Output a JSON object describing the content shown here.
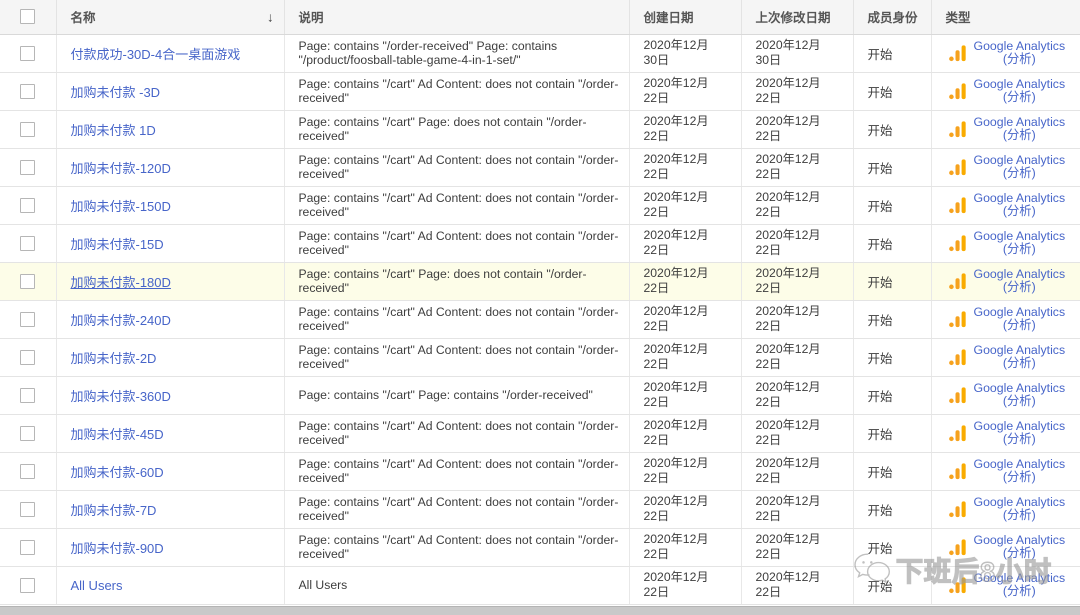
{
  "table": {
    "sort_indicator": "↓",
    "columns": [
      {
        "key": "check",
        "label": ""
      },
      {
        "key": "name",
        "label": "名称"
      },
      {
        "key": "desc",
        "label": "说明"
      },
      {
        "key": "cdate",
        "label": "创建日期"
      },
      {
        "key": "mdate",
        "label": "上次修改日期"
      },
      {
        "key": "member",
        "label": "成员身份"
      },
      {
        "key": "type",
        "label": "类型"
      }
    ],
    "type_icon_name": "google-analytics-icon",
    "type_label_main": "Google Analytics",
    "type_label_sub": "(分析)",
    "accent_link_color": "#4765c9",
    "hover_row_color": "#fdfde8",
    "icon_orange": "#f9ab00",
    "rows": [
      {
        "name": "付款成功-30D-4合一桌面游戏",
        "desc": "Page: contains \"/order-received\" Page: contains \"/product/foosball-table-game-4-in-1-set/\"",
        "cdate_line1": "2020年12月",
        "cdate_line2": "30日",
        "mdate_line1": "2020年12月",
        "mdate_line2": "30日",
        "member": "开始",
        "highlighted": false
      },
      {
        "name": "加购未付款 -3D",
        "desc": "Page: contains \"/cart\" Ad Content: does not contain \"/order-received\"",
        "cdate_line1": "2020年12月",
        "cdate_line2": "22日",
        "mdate_line1": "2020年12月",
        "mdate_line2": "22日",
        "member": "开始",
        "highlighted": false
      },
      {
        "name": "加购未付款 1D",
        "desc": "Page: contains \"/cart\" Page: does not contain \"/order-received\"",
        "cdate_line1": "2020年12月",
        "cdate_line2": "22日",
        "mdate_line1": "2020年12月",
        "mdate_line2": "22日",
        "member": "开始",
        "highlighted": false
      },
      {
        "name": "加购未付款-120D",
        "desc": "Page: contains \"/cart\" Ad Content: does not contain \"/order-received\"",
        "cdate_line1": "2020年12月",
        "cdate_line2": "22日",
        "mdate_line1": "2020年12月",
        "mdate_line2": "22日",
        "member": "开始",
        "highlighted": false
      },
      {
        "name": "加购未付款-150D",
        "desc": "Page: contains \"/cart\" Ad Content: does not contain \"/order-received\"",
        "cdate_line1": "2020年12月",
        "cdate_line2": "22日",
        "mdate_line1": "2020年12月",
        "mdate_line2": "22日",
        "member": "开始",
        "highlighted": false
      },
      {
        "name": "加购未付款-15D",
        "desc": "Page: contains \"/cart\" Ad Content: does not contain \"/order-received\"",
        "cdate_line1": "2020年12月",
        "cdate_line2": "22日",
        "mdate_line1": "2020年12月",
        "mdate_line2": "22日",
        "member": "开始",
        "highlighted": false
      },
      {
        "name": "加购未付款-180D",
        "desc": "Page: contains \"/cart\" Page: does not contain \"/order-received\"",
        "cdate_line1": "2020年12月",
        "cdate_line2": "22日",
        "mdate_line1": "2020年12月",
        "mdate_line2": "22日",
        "member": "开始",
        "highlighted": true
      },
      {
        "name": "加购未付款-240D",
        "desc": "Page: contains \"/cart\" Ad Content: does not contain \"/order-received\"",
        "cdate_line1": "2020年12月",
        "cdate_line2": "22日",
        "mdate_line1": "2020年12月",
        "mdate_line2": "22日",
        "member": "开始",
        "highlighted": false
      },
      {
        "name": "加购未付款-2D",
        "desc": "Page: contains \"/cart\" Ad Content: does not contain \"/order-received\"",
        "cdate_line1": "2020年12月",
        "cdate_line2": "22日",
        "mdate_line1": "2020年12月",
        "mdate_line2": "22日",
        "member": "开始",
        "highlighted": false
      },
      {
        "name": "加购未付款-360D",
        "desc": "Page: contains \"/cart\" Page: contains \"/order-received\"",
        "cdate_line1": "2020年12月",
        "cdate_line2": "22日",
        "mdate_line1": "2020年12月",
        "mdate_line2": "22日",
        "member": "开始",
        "highlighted": false
      },
      {
        "name": "加购未付款-45D",
        "desc": "Page: contains \"/cart\" Ad Content: does not contain \"/order-received\"",
        "cdate_line1": "2020年12月",
        "cdate_line2": "22日",
        "mdate_line1": "2020年12月",
        "mdate_line2": "22日",
        "member": "开始",
        "highlighted": false
      },
      {
        "name": "加购未付款-60D",
        "desc": "Page: contains \"/cart\" Ad Content: does not contain \"/order-received\"",
        "cdate_line1": "2020年12月",
        "cdate_line2": "22日",
        "mdate_line1": "2020年12月",
        "mdate_line2": "22日",
        "member": "开始",
        "highlighted": false
      },
      {
        "name": "加购未付款-7D",
        "desc": "Page: contains \"/cart\" Ad Content: does not contain \"/order-received\"",
        "cdate_line1": "2020年12月",
        "cdate_line2": "22日",
        "mdate_line1": "2020年12月",
        "mdate_line2": "22日",
        "member": "开始",
        "highlighted": false
      },
      {
        "name": "加购未付款-90D",
        "desc": "Page: contains \"/cart\" Ad Content: does not contain \"/order-received\"",
        "cdate_line1": "2020年12月",
        "cdate_line2": "22日",
        "mdate_line1": "2020年12月",
        "mdate_line2": "22日",
        "member": "开始",
        "highlighted": false
      },
      {
        "name": "All Users",
        "desc": "All Users",
        "cdate_line1": "2020年12月",
        "cdate_line2": "22日",
        "mdate_line1": "2020年12月",
        "mdate_line2": "22日",
        "member": "开始",
        "highlighted": false
      }
    ]
  },
  "watermark": {
    "text": "下班后8小时",
    "logo_name": "wechat-icon"
  }
}
